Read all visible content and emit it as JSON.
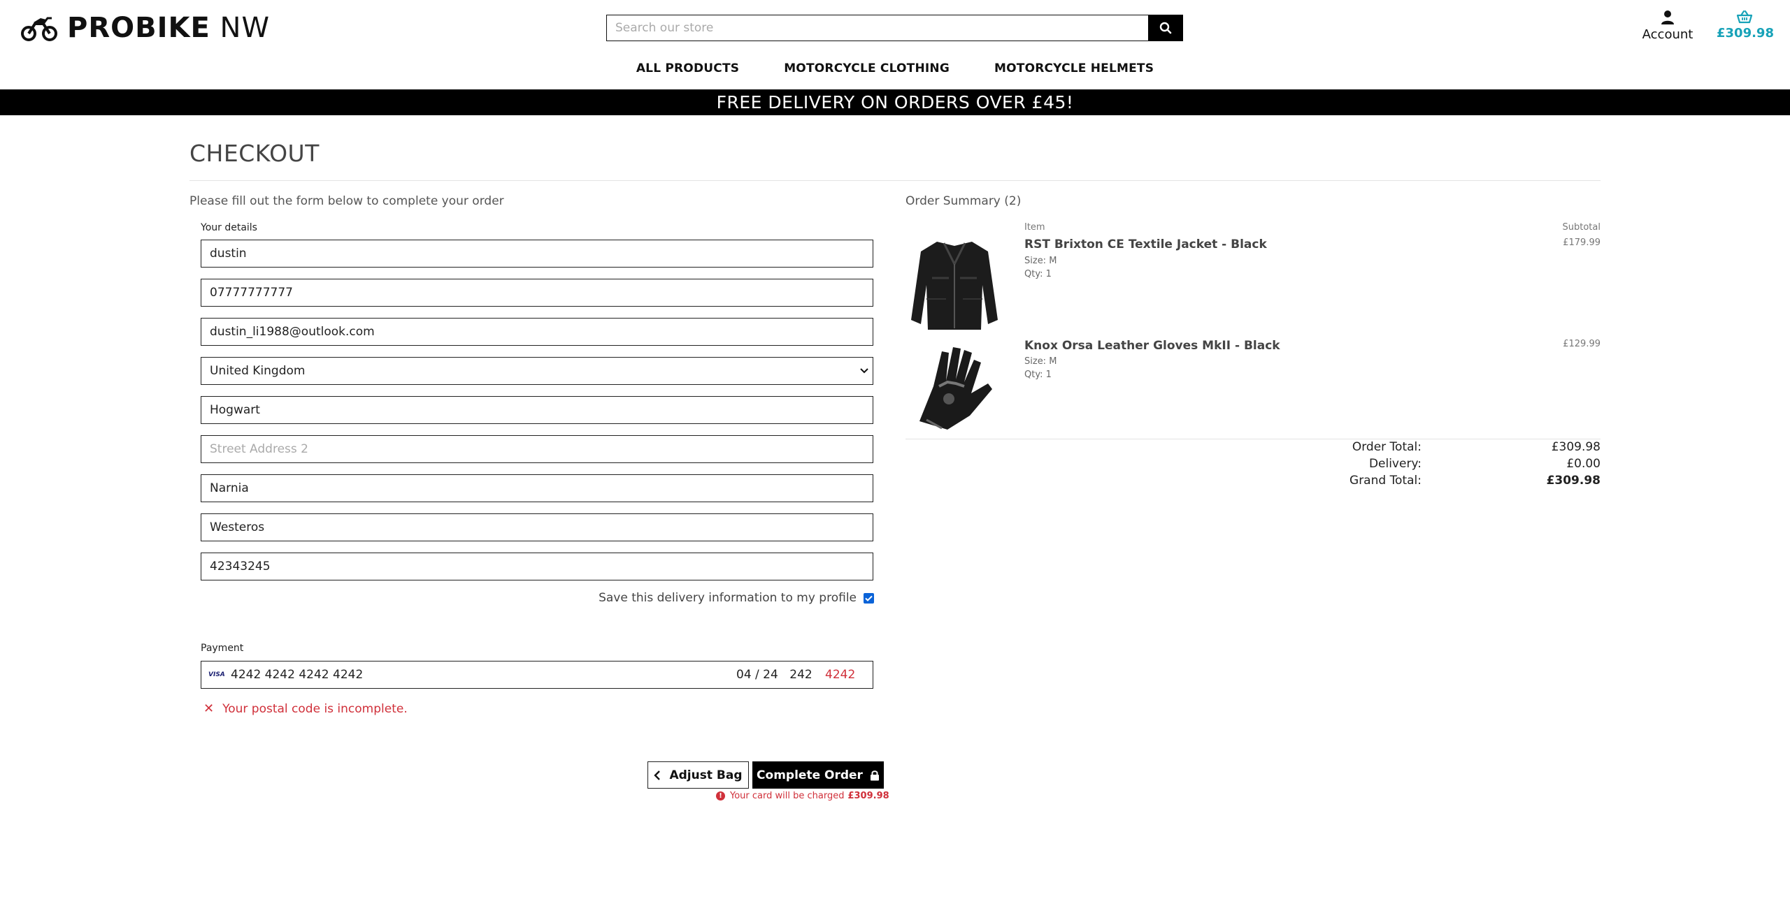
{
  "header": {
    "brand_bold": "PROBIKE",
    "brand_light": "NW",
    "search_placeholder": "Search our store",
    "account_label": "Account",
    "basket_total": "£309.98"
  },
  "nav": {
    "items": [
      "ALL PRODUCTS",
      "MOTORCYCLE CLOTHING",
      "MOTORCYCLE HELMETS"
    ]
  },
  "banner": "FREE DELIVERY ON ORDERS OVER £45!",
  "checkout": {
    "title": "CHECKOUT",
    "intro": "Please fill out the form below to complete your order",
    "details_label": "Your details",
    "fields": {
      "full_name": "dustin",
      "phone": "07777777777",
      "email": "dustin_li1988@outlook.com",
      "country": "United Kingdom",
      "street_address_1": "Hogwart",
      "street_address_2": "",
      "street_address_2_placeholder": "Street Address 2",
      "town_city": "Narnia",
      "county": "Westeros",
      "postcode": "42343245"
    },
    "save_info_label": "Save this delivery information to my profile",
    "save_info_checked": true,
    "payment_label": "Payment",
    "card": {
      "brand": "VISA",
      "number": "4242 4242 4242 4242",
      "expiry": "04 / 24",
      "cvc": "242",
      "postal": "4242"
    },
    "card_error": "Your postal code is incomplete.",
    "adjust_bag_label": "Adjust Bag",
    "complete_order_label": "Complete Order",
    "charge_note": "Your card will be charged",
    "charge_amount": "£309.98"
  },
  "summary": {
    "title": "Order Summary (2)",
    "col_item": "Item",
    "col_subtotal": "Subtotal",
    "items": [
      {
        "name": "RST Brixton CE Textile Jacket - Black",
        "size": "Size: M",
        "qty": "Qty: 1",
        "price": "£179.99"
      },
      {
        "name": "Knox Orsa Leather Gloves MkII - Black",
        "size": "Size: M",
        "qty": "Qty: 1",
        "price": "£129.99"
      }
    ],
    "order_total_label": "Order Total:",
    "order_total": "£309.98",
    "delivery_label": "Delivery:",
    "delivery": "£0.00",
    "grand_total_label": "Grand Total:",
    "grand_total": "£309.98"
  },
  "colors": {
    "accent_teal": "#17a2b8",
    "error_red": "#d0303a",
    "checkbox_blue": "#0a63d8"
  }
}
